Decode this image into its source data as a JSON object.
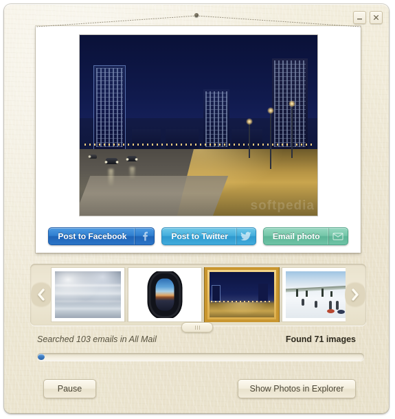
{
  "window": {
    "minimize_label": "minimize-icon",
    "close_label": "close-icon"
  },
  "photo": {
    "caption": "night-cityscape-photo",
    "watermark": "softpedia"
  },
  "share_buttons": [
    {
      "label": "Post to Facebook",
      "icon": "facebook-icon",
      "color": "#2f7fd0"
    },
    {
      "label": "Post to Twitter",
      "icon": "twitter-bird-icon",
      "color": "#45aedd"
    },
    {
      "label": "Email photo",
      "icon": "envelope-icon",
      "color": "#74c6a9"
    }
  ],
  "filmstrip": {
    "prev_label": "chevron-left-icon",
    "next_label": "chevron-right-icon",
    "scroll_handle": "scroll-grip-handle",
    "thumbnails": [
      {
        "name": "clouds-aerial-thumbnail",
        "selected": false
      },
      {
        "name": "airplane-window-thumbnail",
        "selected": false
      },
      {
        "name": "city-night-thumbnail",
        "selected": true
      },
      {
        "name": "snow-slope-thumbnail",
        "selected": false
      }
    ]
  },
  "status": {
    "searched_text": "Searched 103 emails in All Mail",
    "found_text": "Found 71 images",
    "progress_percent": 2
  },
  "footer": {
    "pause_label": "Pause",
    "explorer_label": "Show Photos in Explorer"
  }
}
